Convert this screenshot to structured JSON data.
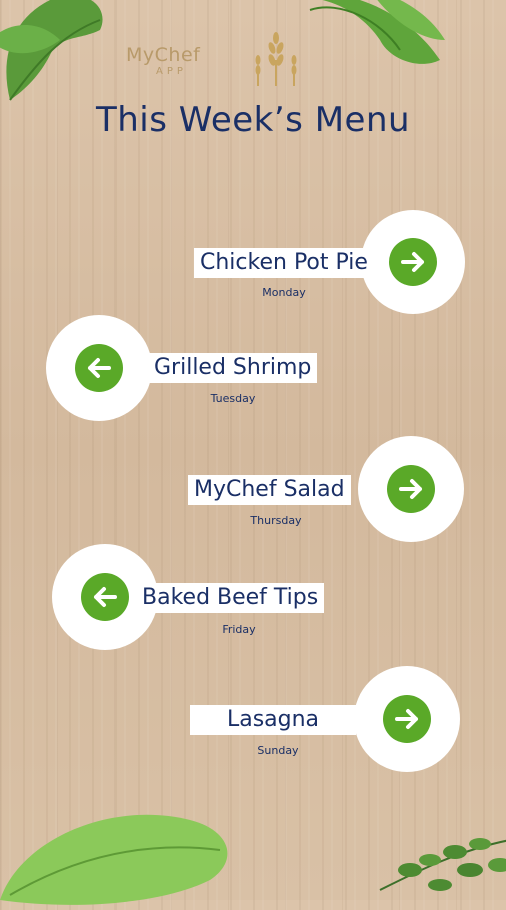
{
  "brand": {
    "name": "MyChef",
    "sub": "APP"
  },
  "title": "This Week’s Menu",
  "menu": [
    {
      "dish": "Chicken Pot Pie",
      "day": "Monday",
      "direction": "right"
    },
    {
      "dish": "Grilled Shrimp",
      "day": "Tuesday",
      "direction": "left"
    },
    {
      "dish": "MyChef Salad",
      "day": "Thursday",
      "direction": "right"
    },
    {
      "dish": "Baked Beef Tips",
      "day": "Friday",
      "direction": "left"
    },
    {
      "dish": "Lasagna",
      "day": "Sunday",
      "direction": "right"
    }
  ],
  "colors": {
    "title": "#1a2f66",
    "accent": "#5aa928",
    "logo": "#b89a6a"
  },
  "icons": {
    "right": "arrow-right-icon",
    "left": "arrow-left-icon"
  }
}
